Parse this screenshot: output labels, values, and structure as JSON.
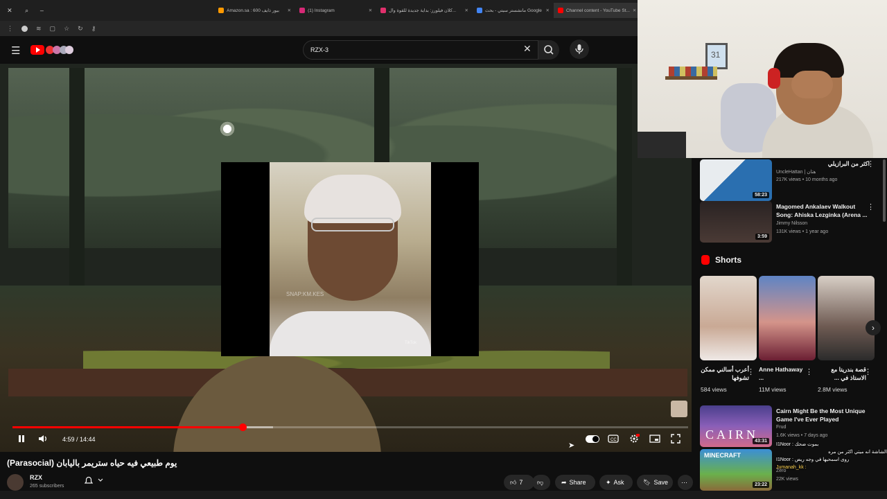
{
  "browser": {
    "tabs": [
      {
        "label": "Amazon.sa : 600 بيور ذايف",
        "color": "#ff9900"
      },
      {
        "label": "(1) Instagram",
        "color": "#d62976"
      },
      {
        "label": "كلان فيلورز: بداية جديدة للقوة وال...",
        "color": "#e1306c"
      },
      {
        "label": "مانشستر سيتي - بحث Google",
        "color": "#4285f4"
      },
      {
        "label": "Channel content - YouTube St...",
        "color": "#ff0000"
      }
    ]
  },
  "search": {
    "query": "RZX-3"
  },
  "player": {
    "time": "4:59 / 14:44",
    "progress_fraction": 0.341,
    "buffer_fraction": 0.386,
    "overlay_watermark": "SNAP:KM.KES",
    "overlay_tiktok": "TikTok"
  },
  "video": {
    "title": "يوم طبيعي فيه حياه ستريمر باليابان (Parasocial)",
    "channel": "RZX",
    "subscribers": "265 subscribers",
    "like_count": "7",
    "share_label": "Share",
    "ask_label": "Ask",
    "save_label": "Save"
  },
  "sidebar": {
    "videos": [
      {
        "title": "اكثر من البرازيلي",
        "channel": "UncleHattan | هتان",
        "meta": "217K views • 10 months ago",
        "duration": "58:23",
        "thumb": "#2a6fb0"
      },
      {
        "title": "Magomed Ankalaev Walkout Song: Ahiska Lezginka (Arena ...",
        "channel": "Jimmy Nilsson",
        "meta": "131K views • 1 year ago",
        "duration": "3:59",
        "thumb": "#3a2d2a"
      }
    ],
    "shorts_label": "Shorts",
    "shorts": [
      {
        "title": "أعرب أسالني ممكن تشوفها",
        "views": "584 views",
        "thumb": "#c9a995"
      },
      {
        "title": "Anne Hathaway ...",
        "views": "11M views",
        "thumb": "#d4948a"
      },
      {
        "title": "قصة بندريتا مع الاستاذ في ...",
        "views": "2.8M views",
        "thumb": "#6e5a52"
      }
    ],
    "bottom_videos": [
      {
        "title": "Cairn Might Be the Most Unique Game I've Ever Played",
        "channel": "Frud",
        "meta": "1.6K views • 7 days ago",
        "duration": "43:31",
        "thumb_text": "CAIRN",
        "thumb": "#8a5fb8"
      },
      {
        "title": "",
        "channel": "Zero",
        "meta": "22K views",
        "duration": "23:22",
        "thumb_text": "MINECRAFT",
        "thumb": "#3b8fd6"
      }
    ]
  },
  "chat": [
    "I1Noor : بموت ضحك",
    "الشاشة انه ميتي اكثر من مره",
    "I1Noor : روى اسمحيها في وجه ريض",
    "Jumanah_kk :"
  ],
  "webcam": {
    "frame_text": "31"
  }
}
